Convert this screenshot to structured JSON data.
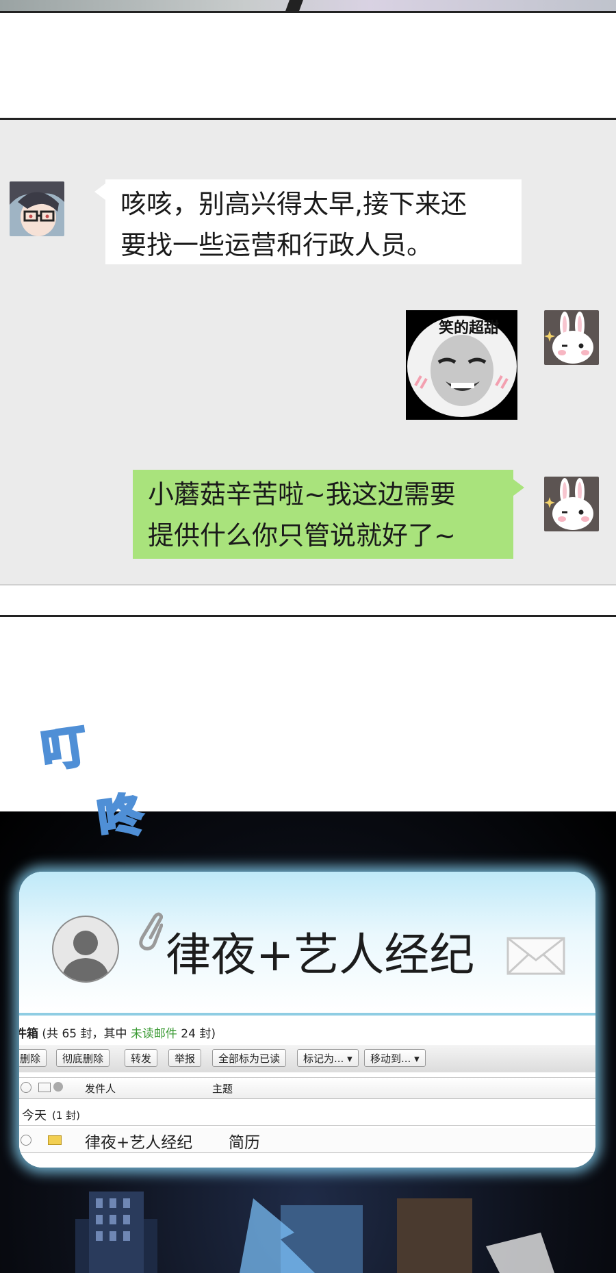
{
  "chat": {
    "messages": [
      {
        "side": "left",
        "avatar": "glasses-boy-avatar",
        "text": "咳咳，别高兴得太早，接下来还要找一些运营和行政人员。",
        "lines": [
          "咳咳，别高兴得太早,接下来还",
          "要找一些运营和行政人员。"
        ]
      },
      {
        "side": "right",
        "avatar": "bunny-avatar",
        "sticker_text": "笑的超甜"
      },
      {
        "side": "right",
        "avatar": "bunny-avatar",
        "lines": [
          "小蘑菇辛苦啦~我这边需要",
          "提供什么你只管说就好了~"
        ]
      }
    ]
  },
  "sfx": {
    "char1": "叮",
    "char2": "咚",
    "color": "#4f8fd6"
  },
  "email_card": {
    "sender_name": "律夜+艺人经纪",
    "inbox": {
      "folder": "件箱",
      "summary_prefix": "(共 65 封，其中 ",
      "summary_unread": "未读邮件",
      "summary_suffix": " 24 封)",
      "buttons": [
        "删除",
        "彻底删除",
        "转发",
        "举报",
        "全部标为已读",
        "标记为... ▾",
        "移动到... ▾"
      ],
      "columns": [
        "发件人",
        "主题"
      ],
      "group_label": "今天",
      "group_count": "(1 封)",
      "row": {
        "sender": "律夜+艺人经纪",
        "subject": "简历"
      }
    }
  },
  "colors": {
    "chat_bg": "#ebebeb",
    "green_bubble": "#a9e37c",
    "glow": "#8cdcff",
    "unread": "#3a9a33"
  }
}
